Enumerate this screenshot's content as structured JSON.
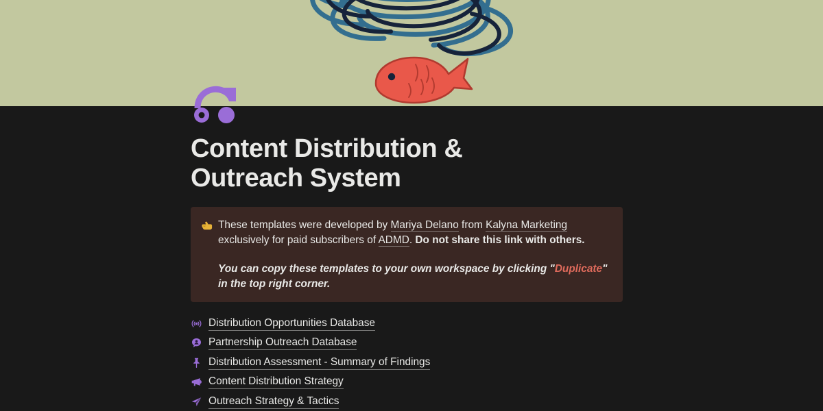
{
  "cover": {
    "name": "goldfish-tangle-illustration",
    "background_color": "#c2c89f",
    "fish_color": "#e9584a",
    "scribble_colors": [
      "#2c6a8f",
      "#16233a"
    ]
  },
  "page_icon": {
    "name": "repeat-arrow-icon",
    "color": "#9a6dd7"
  },
  "header": {
    "title": "Content Distribution & Outreach System"
  },
  "callout": {
    "emoji_name": "pointing-right-hand",
    "background_color": "#3a2723",
    "paragraph1": {
      "part1": "These templates were developed by ",
      "link1": "Mariya Delano",
      "part2": " from ",
      "link2": "Kalyna Marketing",
      "part3": " exclusively for paid subscribers of ",
      "link3": "ADMD",
      "part4": ". ",
      "bold": "Do not share this link with others."
    },
    "paragraph2": {
      "part1": "You can copy these templates to your own workspace by clicking \"",
      "highlight": "Duplicate",
      "part2": "\" in the top right corner.",
      "highlight_color": "#e06b5c"
    }
  },
  "links": [
    {
      "icon": "broadcast-icon",
      "label": "Distribution Opportunities Database"
    },
    {
      "icon": "person-bubble-icon",
      "label": "Partnership Outreach Database"
    },
    {
      "icon": "pushpin-icon",
      "label": "Distribution Assessment - Summary of Findings"
    },
    {
      "icon": "megaphone-icon",
      "label": "Content Distribution Strategy"
    },
    {
      "icon": "paper-plane-icon",
      "label": "Outreach Strategy & Tactics"
    }
  ]
}
